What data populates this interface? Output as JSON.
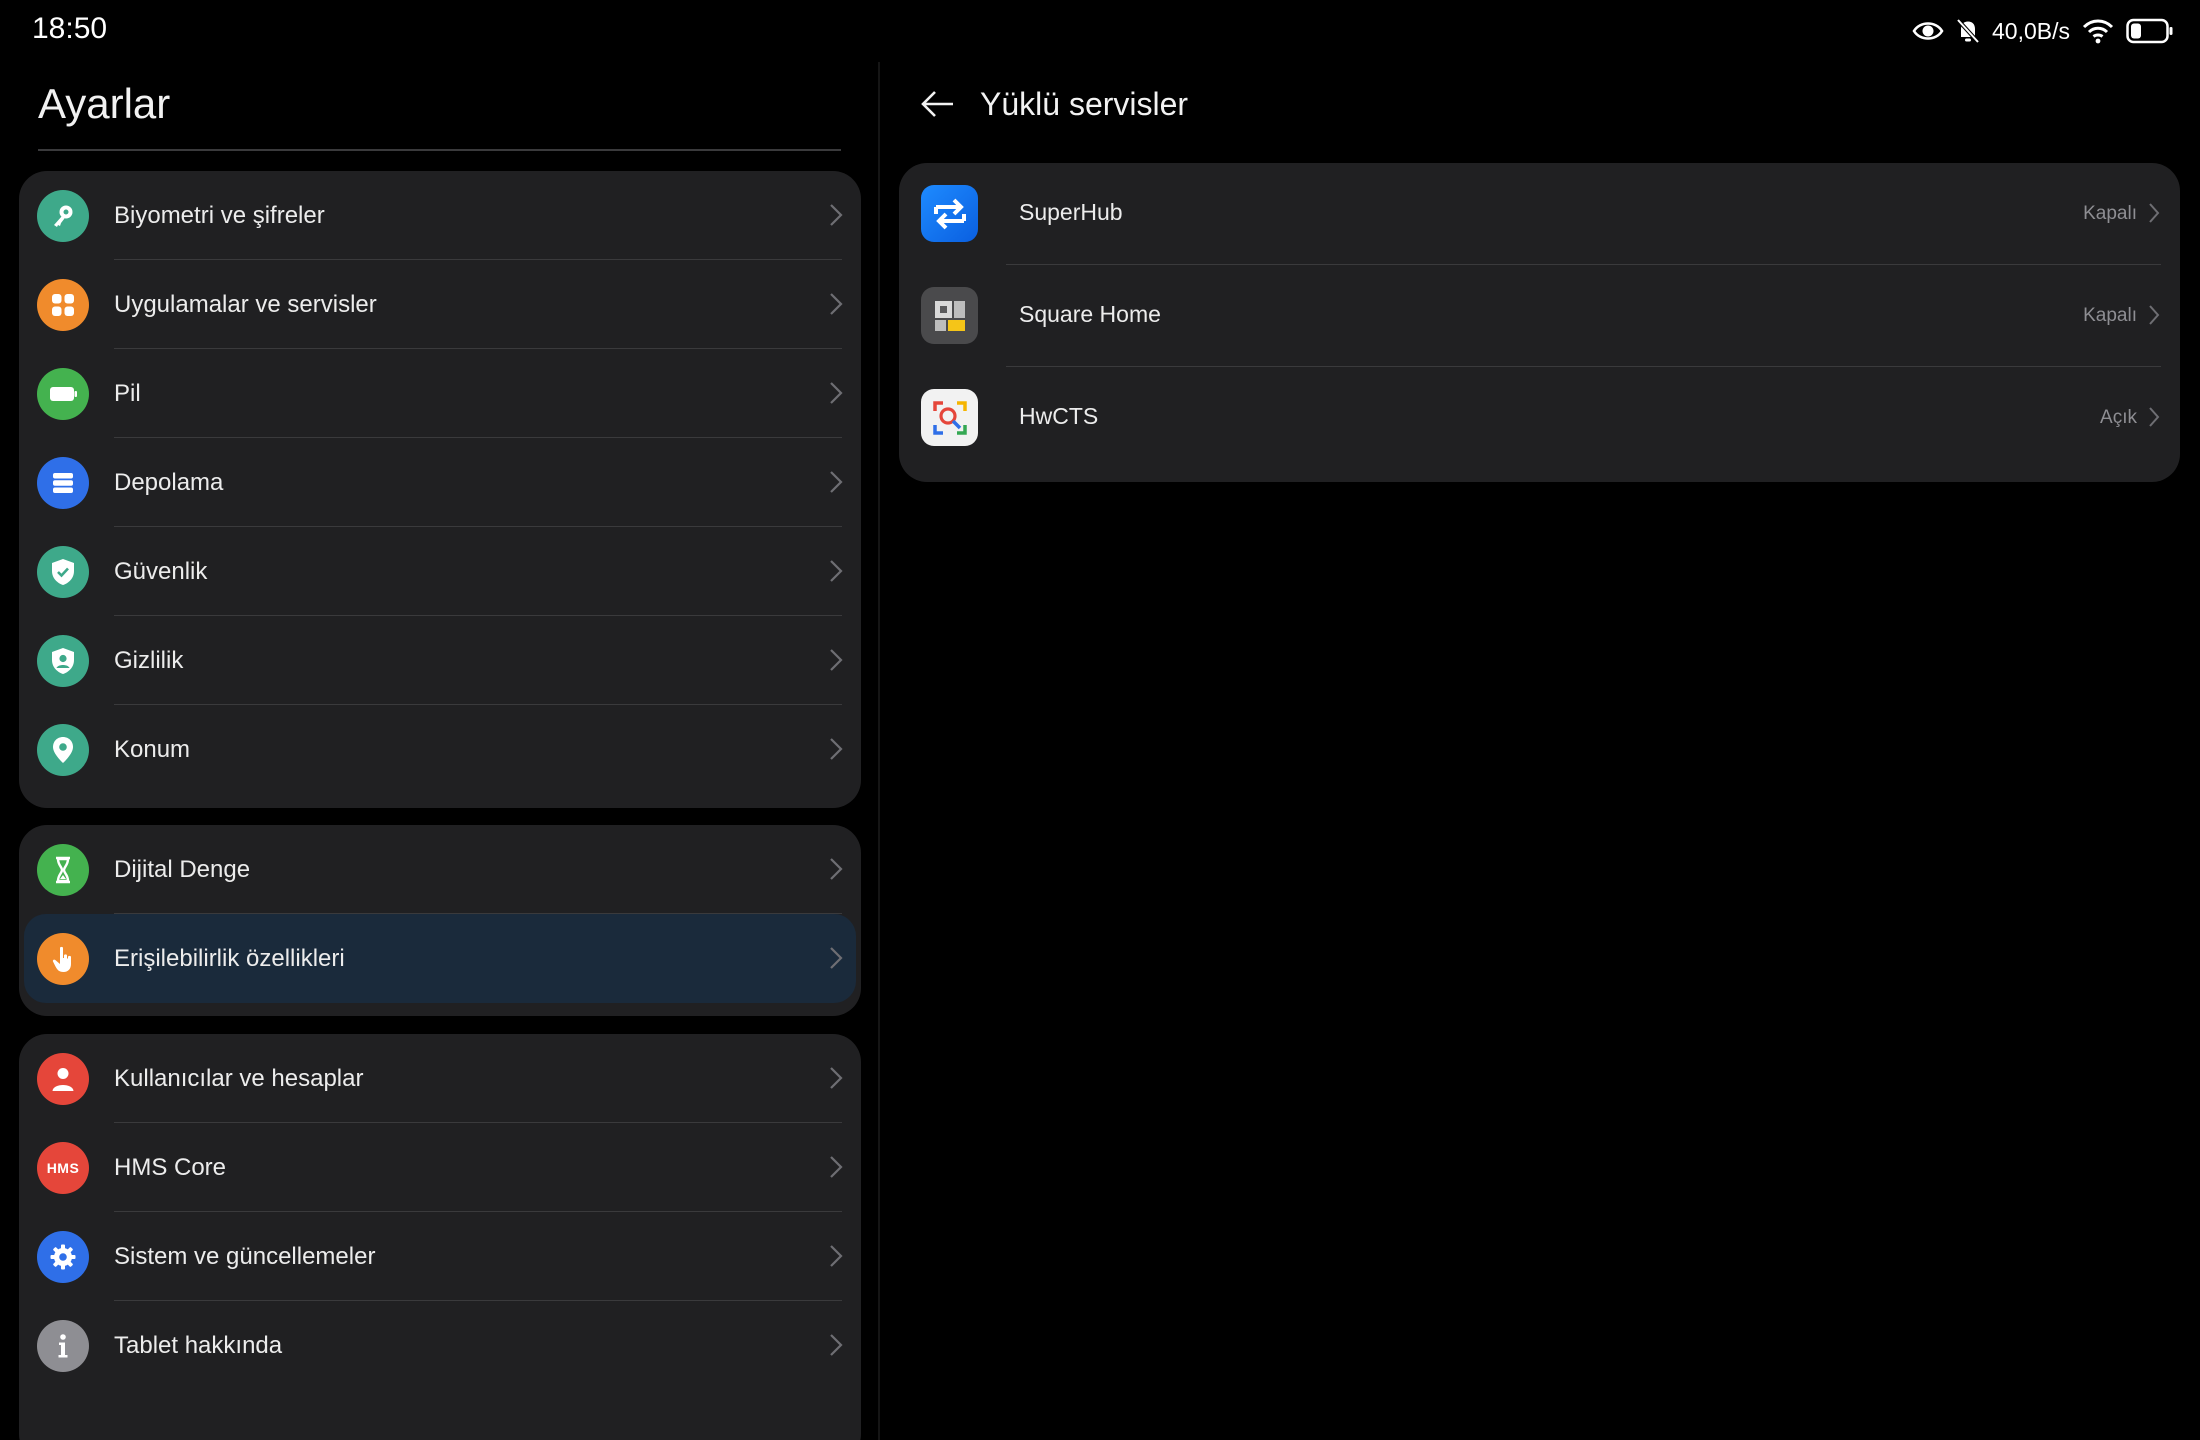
{
  "status_bar": {
    "time": "18:50",
    "net_speed": "40,0B/s",
    "icons": [
      "eye-comfort-icon",
      "bell-muted-icon",
      "wifi-icon",
      "battery-icon"
    ]
  },
  "settings": {
    "title": "Ayarlar",
    "groups": [
      {
        "items": [
          {
            "label": "Biyometri ve şifreler",
            "icon": "key-icon",
            "color": "#3ea98a"
          },
          {
            "label": "Uygulamalar ve servisler",
            "icon": "apps-grid-icon",
            "color": "#f08b2c"
          },
          {
            "label": "Pil",
            "icon": "battery-icon",
            "color": "#44b24f"
          },
          {
            "label": "Depolama",
            "icon": "storage-icon",
            "color": "#2f6fe8"
          },
          {
            "label": "Güvenlik",
            "icon": "shield-check-icon",
            "color": "#3ea98a"
          },
          {
            "label": "Gizlilik",
            "icon": "privacy-shield-icon",
            "color": "#3ea98a"
          },
          {
            "label": "Konum",
            "icon": "location-pin-icon",
            "color": "#3ea98a"
          }
        ]
      },
      {
        "items": [
          {
            "label": "Dijital Denge",
            "icon": "hourglass-icon",
            "color": "#44b24f"
          },
          {
            "label": "Erişilebilirlik özellikleri",
            "icon": "hand-tap-icon",
            "color": "#f08b2c",
            "selected": true
          }
        ]
      },
      {
        "items": [
          {
            "label": "Kullanıcılar ve hesaplar",
            "icon": "user-icon",
            "color": "#e5463a"
          },
          {
            "label": "HMS Core",
            "icon": "hms-icon",
            "color": "#e5463a",
            "icon_text": "HMS"
          },
          {
            "label": "Sistem ve güncellemeler",
            "icon": "gear-icon",
            "color": "#2f6fe8"
          },
          {
            "label": "Tablet hakkında",
            "icon": "info-icon",
            "color": "#8e8e93"
          }
        ]
      }
    ]
  },
  "detail": {
    "title": "Yüklü servisler",
    "services": [
      {
        "name": "SuperHub",
        "status": "Kapalı",
        "icon": "superhub-icon"
      },
      {
        "name": "Square Home",
        "status": "Kapalı",
        "icon": "square-home-icon"
      },
      {
        "name": "HwCTS",
        "status": "Açık",
        "icon": "hwcts-icon"
      }
    ]
  },
  "colors": {
    "background": "#000000",
    "card": "#202022",
    "selected_row": "#1a2a3b",
    "secondary_text": "#8e8e93"
  }
}
